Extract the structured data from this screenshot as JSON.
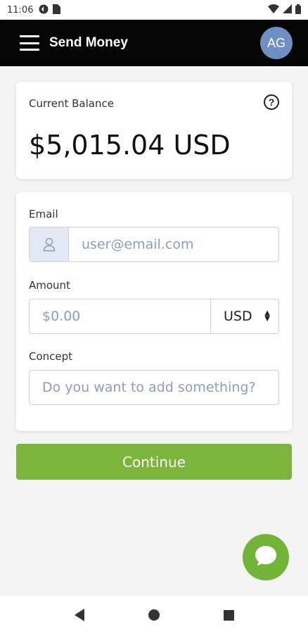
{
  "status_bar": {
    "time": "11:06"
  },
  "app_bar": {
    "title": "Send Money",
    "avatar_initials": "AG"
  },
  "balance": {
    "label": "Current Balance",
    "amount": "$5,015.04 USD",
    "help_icon": "question-circle-icon"
  },
  "form": {
    "email": {
      "label": "Email",
      "placeholder": "user@email.com",
      "icon": "user-icon"
    },
    "amount": {
      "label": "Amount",
      "placeholder": "$0.00",
      "currency": "USD"
    },
    "concept": {
      "label": "Concept",
      "placeholder": "Do you want to add something?"
    }
  },
  "continue_label": "Continue",
  "colors": {
    "app_bar": "#050505",
    "avatar": "#6f8fc4",
    "accent_green": "#7cb53c",
    "input_border": "#c9d2e3",
    "placeholder": "#8e9dbb"
  }
}
